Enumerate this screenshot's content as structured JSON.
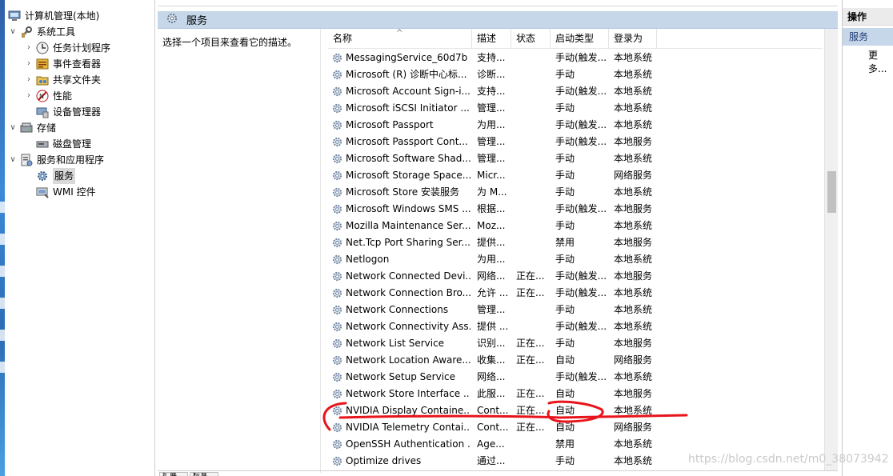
{
  "tree": {
    "root": "计算机管理(本地)",
    "system_tools": "系统工具",
    "task_scheduler": "任务计划程序",
    "event_viewer": "事件查看器",
    "shared_folders": "共享文件夹",
    "performance": "性能",
    "device_manager": "设备管理器",
    "storage": "存储",
    "disk_management": "磁盘管理",
    "services_apps": "服务和应用程序",
    "services": "服务",
    "wmi": "WMI 控件"
  },
  "center": {
    "header_title": "服务",
    "description_prompt": "选择一个项目来查看它的描述。",
    "columns": {
      "name": "名称",
      "desc": "描述",
      "status": "状态",
      "startup": "启动类型",
      "logon": "登录为"
    },
    "sort_arrow": "^",
    "bottom_tabs": [
      "扩展",
      "标准"
    ]
  },
  "services": [
    {
      "name": "MessagingService_60d7b",
      "desc": "支持...",
      "status": "",
      "startup": "手动(触发...",
      "logon": "本地系统"
    },
    {
      "name": "Microsoft (R) 诊断中心标...",
      "desc": "诊断...",
      "status": "",
      "startup": "手动",
      "logon": "本地系统"
    },
    {
      "name": "Microsoft Account Sign-i...",
      "desc": "支持...",
      "status": "",
      "startup": "手动(触发...",
      "logon": "本地系统"
    },
    {
      "name": "Microsoft iSCSI Initiator ...",
      "desc": "管理...",
      "status": "",
      "startup": "手动",
      "logon": "本地系统"
    },
    {
      "name": "Microsoft Passport",
      "desc": "为用...",
      "status": "",
      "startup": "手动(触发...",
      "logon": "本地系统"
    },
    {
      "name": "Microsoft Passport Cont...",
      "desc": "管理...",
      "status": "",
      "startup": "手动(触发...",
      "logon": "本地服务"
    },
    {
      "name": "Microsoft Software Shad...",
      "desc": "管理...",
      "status": "",
      "startup": "手动",
      "logon": "本地系统"
    },
    {
      "name": "Microsoft Storage Space...",
      "desc": "Micr...",
      "status": "",
      "startup": "手动",
      "logon": "网络服务"
    },
    {
      "name": "Microsoft Store 安装服务",
      "desc": "为 M...",
      "status": "",
      "startup": "手动",
      "logon": "本地系统"
    },
    {
      "name": "Microsoft Windows SMS ...",
      "desc": "根据...",
      "status": "",
      "startup": "手动(触发...",
      "logon": "本地服务"
    },
    {
      "name": "Mozilla Maintenance Ser...",
      "desc": "Moz...",
      "status": "",
      "startup": "手动",
      "logon": "本地系统"
    },
    {
      "name": "Net.Tcp Port Sharing Ser...",
      "desc": "提供...",
      "status": "",
      "startup": "禁用",
      "logon": "本地服务"
    },
    {
      "name": "Netlogon",
      "desc": "为用...",
      "status": "",
      "startup": "手动",
      "logon": "本地系统"
    },
    {
      "name": "Network Connected Devi...",
      "desc": "网络...",
      "status": "正在...",
      "startup": "手动(触发...",
      "logon": "本地服务"
    },
    {
      "name": "Network Connection Bro...",
      "desc": "允许 ...",
      "status": "正在...",
      "startup": "手动(触发...",
      "logon": "本地系统"
    },
    {
      "name": "Network Connections",
      "desc": "管理...",
      "status": "",
      "startup": "手动",
      "logon": "本地系统"
    },
    {
      "name": "Network Connectivity Ass...",
      "desc": "提供 ...",
      "status": "",
      "startup": "手动(触发...",
      "logon": "本地系统"
    },
    {
      "name": "Network List Service",
      "desc": "识别...",
      "status": "正在...",
      "startup": "手动",
      "logon": "本地服务"
    },
    {
      "name": "Network Location Aware...",
      "desc": "收集...",
      "status": "正在...",
      "startup": "自动",
      "logon": "网络服务"
    },
    {
      "name": "Network Setup Service",
      "desc": "网络...",
      "status": "",
      "startup": "手动(触发...",
      "logon": "本地系统"
    },
    {
      "name": "Network Store Interface ...",
      "desc": "此服...",
      "status": "正在...",
      "startup": "自动",
      "logon": "本地服务"
    },
    {
      "name": "NVIDIA Display Containe...",
      "desc": "Cont...",
      "status": "正在...",
      "startup": "自动",
      "logon": "本地系统"
    },
    {
      "name": "NVIDIA Telemetry Contai...",
      "desc": "Cont...",
      "status": "正在...",
      "startup": "自动",
      "logon": "网络服务"
    },
    {
      "name": "OpenSSH Authentication ...",
      "desc": "Age...",
      "status": "",
      "startup": "禁用",
      "logon": "本地系统"
    },
    {
      "name": "Optimize drives",
      "desc": "通过...",
      "status": "",
      "startup": "手动",
      "logon": "本地系统"
    }
  ],
  "right": {
    "title": "操作",
    "section": "服务",
    "more": "更多..."
  },
  "watermark": "https://blog.csdn.net/m0_38073942",
  "colors": {
    "header_blue": "#c6d7ea",
    "annotation_red": "#e8141b",
    "gear_blue": "#5d8fc7"
  }
}
